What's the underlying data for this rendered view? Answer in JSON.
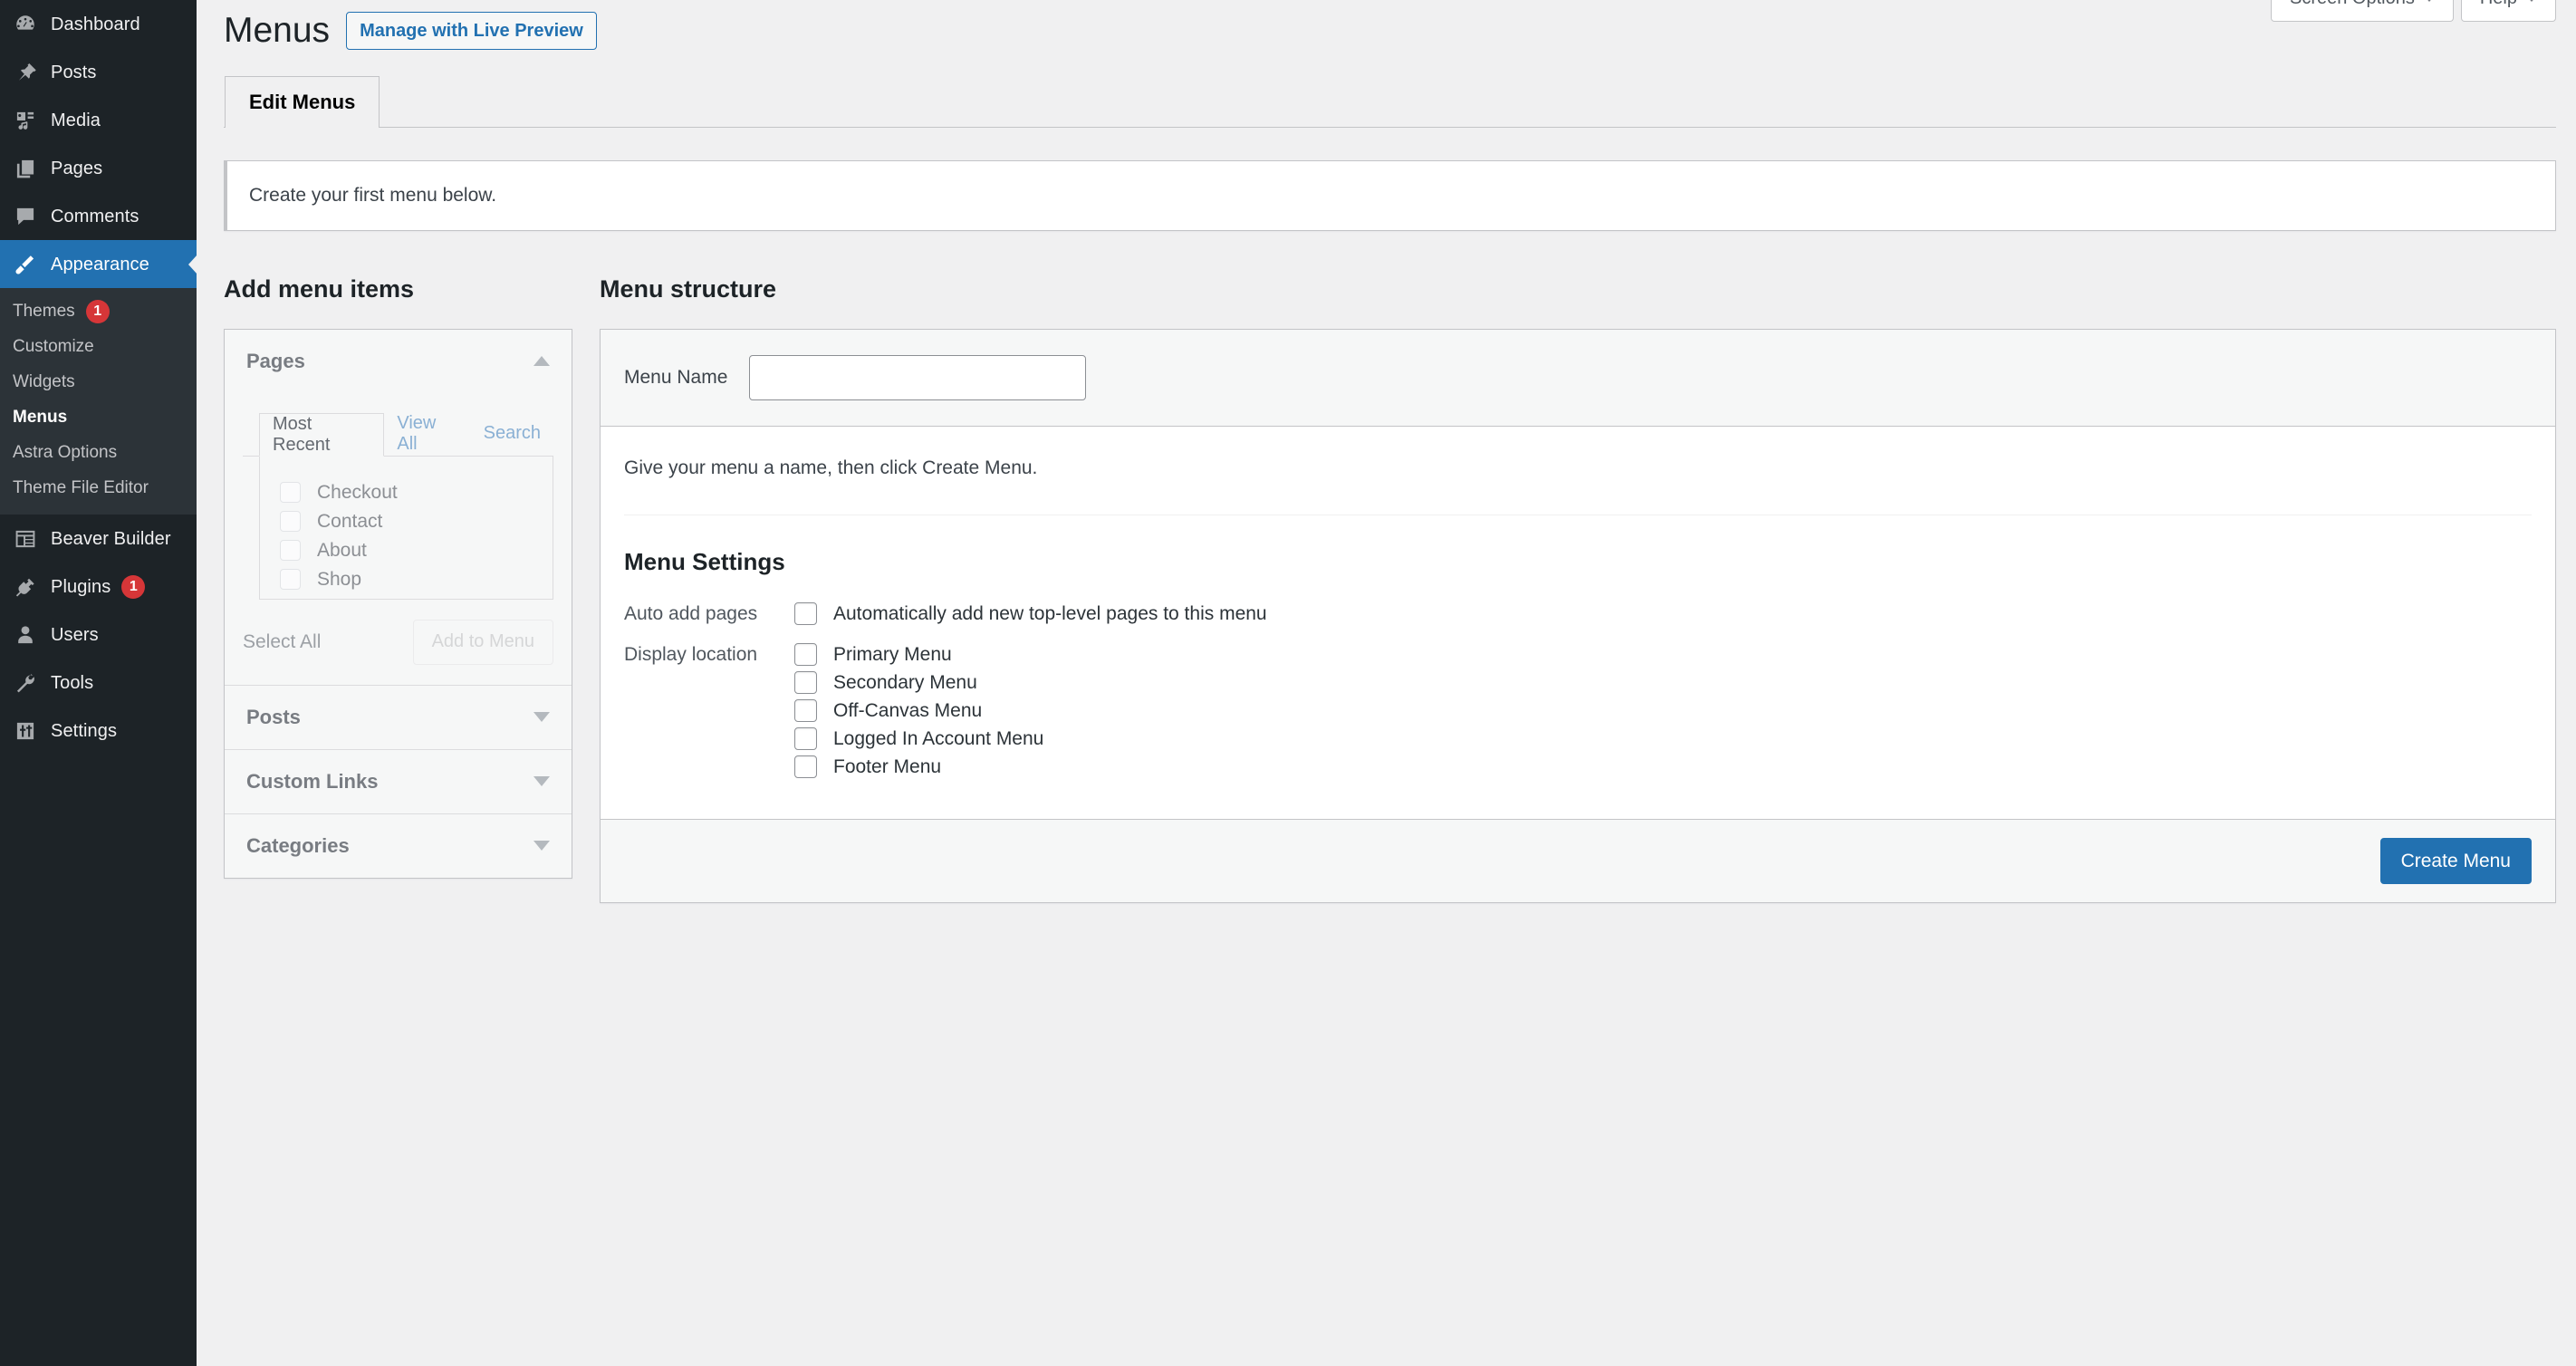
{
  "sidebar": {
    "items": [
      {
        "label": "Dashboard",
        "icon": "dashboard-icon",
        "badge": null,
        "current": false
      },
      {
        "label": "Posts",
        "icon": "pin-icon",
        "badge": null,
        "current": false
      },
      {
        "label": "Media",
        "icon": "media-icon",
        "badge": null,
        "current": false
      },
      {
        "label": "Pages",
        "icon": "pages-icon",
        "badge": null,
        "current": false
      },
      {
        "label": "Comments",
        "icon": "comments-icon",
        "badge": null,
        "current": false
      },
      {
        "label": "Appearance",
        "icon": "brush-icon",
        "badge": null,
        "current": true
      },
      {
        "label": "Beaver Builder",
        "icon": "builder-icon",
        "badge": null,
        "current": false
      },
      {
        "label": "Plugins",
        "icon": "plug-icon",
        "badge": "1",
        "current": false
      },
      {
        "label": "Users",
        "icon": "user-icon",
        "badge": null,
        "current": false
      },
      {
        "label": "Tools",
        "icon": "wrench-icon",
        "badge": null,
        "current": false
      },
      {
        "label": "Settings",
        "icon": "sliders-icon",
        "badge": null,
        "current": false
      }
    ],
    "appearance_submenu": [
      {
        "label": "Themes",
        "badge": "1",
        "current": false
      },
      {
        "label": "Customize",
        "badge": null,
        "current": false
      },
      {
        "label": "Widgets",
        "badge": null,
        "current": false
      },
      {
        "label": "Menus",
        "badge": null,
        "current": true
      },
      {
        "label": "Astra Options",
        "badge": null,
        "current": false
      },
      {
        "label": "Theme File Editor",
        "badge": null,
        "current": false
      }
    ]
  },
  "screen_meta": {
    "screen_options_label": "Screen Options",
    "help_label": "Help"
  },
  "header": {
    "title": "Menus",
    "live_preview_label": "Manage with Live Preview"
  },
  "tabs": [
    {
      "label": "Edit Menus",
      "active": true
    }
  ],
  "notice": {
    "text": "Create your first menu below."
  },
  "add_menu_items": {
    "heading": "Add menu items",
    "sections": [
      {
        "title": "Pages",
        "expanded": true,
        "toggle_icon": "chevron-up-icon",
        "tabs": [
          {
            "label": "Most Recent",
            "active": true
          },
          {
            "label": "View All",
            "active": false
          },
          {
            "label": "Search",
            "active": false
          }
        ],
        "items": [
          {
            "label": "Checkout",
            "checked": false
          },
          {
            "label": "Contact",
            "checked": false
          },
          {
            "label": "About",
            "checked": false
          },
          {
            "label": "Shop",
            "checked": false
          }
        ],
        "select_all_label": "Select All",
        "add_button_label": "Add to Menu",
        "add_button_disabled": true
      },
      {
        "title": "Posts",
        "expanded": false,
        "toggle_icon": "chevron-down-icon"
      },
      {
        "title": "Custom Links",
        "expanded": false,
        "toggle_icon": "chevron-down-icon"
      },
      {
        "title": "Categories",
        "expanded": false,
        "toggle_icon": "chevron-down-icon"
      }
    ]
  },
  "menu_structure": {
    "heading": "Menu structure",
    "menu_name_label": "Menu Name",
    "menu_name_value": "",
    "menu_name_placeholder": "",
    "instructions": "Give your menu a name, then click Create Menu.",
    "settings_heading": "Menu Settings",
    "auto_add_label": "Auto add pages",
    "auto_add_option": {
      "label": "Automatically add new top-level pages to this menu",
      "checked": false
    },
    "display_location_label": "Display location",
    "display_locations": [
      {
        "label": "Primary Menu",
        "checked": false
      },
      {
        "label": "Secondary Menu",
        "checked": false
      },
      {
        "label": "Off-Canvas Menu",
        "checked": false
      },
      {
        "label": "Logged In Account Menu",
        "checked": false
      },
      {
        "label": "Footer Menu",
        "checked": false
      }
    ],
    "create_button_label": "Create Menu"
  },
  "colors": {
    "accent": "#2271b1",
    "sidebar_bg": "#1d2327",
    "submenu_bg": "#2c3338",
    "badge": "#d63638",
    "content_bg": "#f0f0f1"
  }
}
